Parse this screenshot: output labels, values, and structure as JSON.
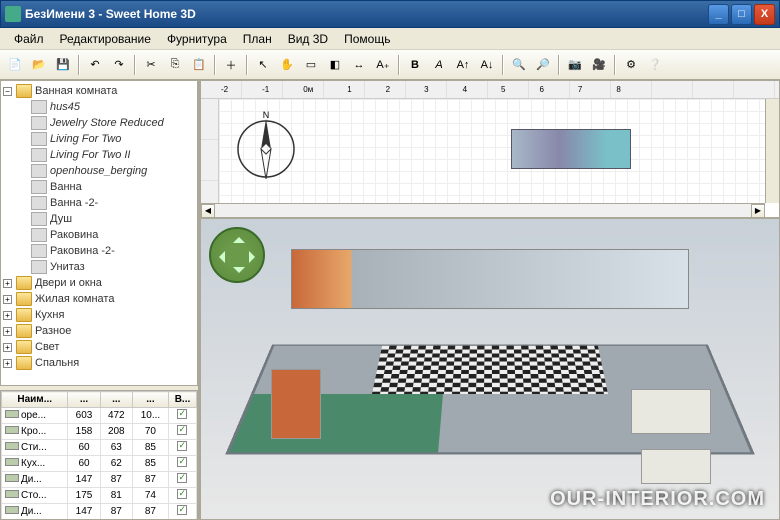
{
  "window": {
    "title": "БезИмени 3 - Sweet Home 3D",
    "min": "_",
    "max": "□",
    "close": "X"
  },
  "menu": [
    "Файл",
    "Редактирование",
    "Фурнитура",
    "План",
    "Вид 3D",
    "Помощь"
  ],
  "toolbar_icons": [
    "new-icon",
    "folder-icon",
    "save-icon",
    "sep",
    "undo-icon",
    "redo-icon",
    "sep",
    "cut-icon",
    "copy-icon",
    "paste-icon",
    "sep",
    "add-furniture-icon",
    "sep",
    "pointer-icon",
    "hand-icon",
    "wall-icon",
    "room-icon",
    "dim-icon",
    "text-icon",
    "sep",
    "bold-icon",
    "italic-icon",
    "font-plus-icon",
    "font-minus-icon",
    "sep",
    "zoom-in-icon",
    "zoom-out-icon",
    "sep",
    "camera-icon",
    "virtual-visit-icon",
    "sep",
    "settings-icon",
    "help-icon"
  ],
  "tree": {
    "root": {
      "label": "Ванная комната",
      "expanded": "−"
    },
    "items": [
      "hus45",
      "Jewelry Store Reduced",
      "Living For Two",
      "Living For Two II",
      "openhouse_berging"
    ],
    "fixtures": [
      "Ванна",
      "Ванна -2-",
      "Душ",
      "Раковина",
      "Раковина -2-",
      "Унитаз"
    ],
    "siblings": [
      "Двери и окна",
      "Жилая комната",
      "Кухня",
      "Разное",
      "Свет",
      "Спальня"
    ]
  },
  "table": {
    "headers": [
      "Наим...",
      "...",
      "...",
      "...",
      "В..."
    ],
    "rows": [
      {
        "name": "ope...",
        "w": "603",
        "d": "472",
        "h": "10..."
      },
      {
        "name": "Кро...",
        "w": "158",
        "d": "208",
        "h": "70"
      },
      {
        "name": "Сти...",
        "w": "60",
        "d": "63",
        "h": "85"
      },
      {
        "name": "Кух...",
        "w": "60",
        "d": "62",
        "h": "85"
      },
      {
        "name": "Ди...",
        "w": "147",
        "d": "87",
        "h": "87"
      },
      {
        "name": "Сто...",
        "w": "175",
        "d": "81",
        "h": "74"
      },
      {
        "name": "Ди...",
        "w": "147",
        "d": "87",
        "h": "87"
      }
    ]
  },
  "plan": {
    "ruler_marks": [
      "-2",
      "-1",
      "0м",
      "1",
      "2",
      "3",
      "4",
      "5",
      "6",
      "7",
      "8"
    ],
    "compass_n": "N"
  },
  "nav": {
    "up": "▲",
    "down": "▼",
    "left": "◀",
    "right": "▶"
  },
  "watermark": "OUR-INTERIOR.COM",
  "scroll": {
    "left": "◀",
    "right": "▶"
  }
}
